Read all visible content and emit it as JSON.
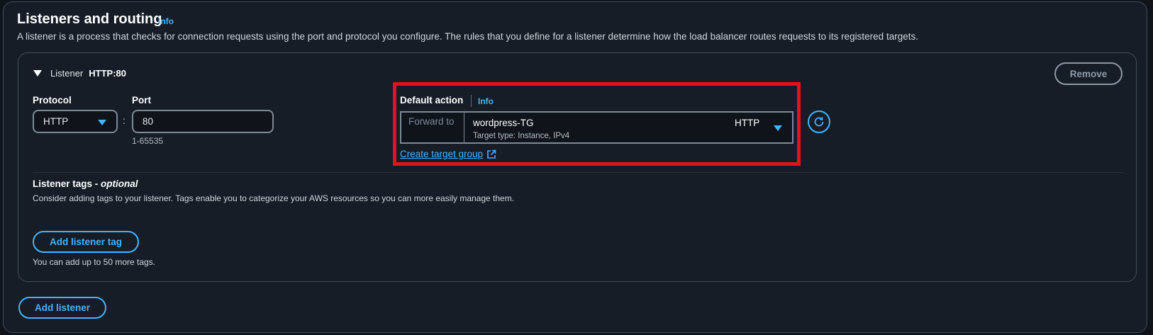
{
  "section": {
    "title": "Listeners and routing",
    "info_label": "Info",
    "description": "A listener is a process that checks for connection requests using the port and protocol you configure. The rules that you define for a listener determine how the load balancer routes requests to its registered targets."
  },
  "listener": {
    "header_label": "Listener",
    "header_value": "HTTP:80",
    "remove_label": "Remove",
    "protocol_label": "Protocol",
    "protocol_value": "HTTP",
    "port_label": "Port",
    "port_value": "80",
    "port_hint": "1-65535",
    "colon": ":"
  },
  "default_action": {
    "label": "Default action",
    "info_label": "Info",
    "forward_to": "Forward to",
    "target_group_name": "wordpress-TG",
    "target_group_sub": "Target type: Instance, IPv4",
    "target_group_protocol": "HTTP",
    "create_link": "Create target group",
    "highlight_color": "#e0141b"
  },
  "tags": {
    "title": "Listener tags - ",
    "title_optional": "optional",
    "description": "Consider adding tags to your listener. Tags enable you to categorize your AWS resources so you can more easily manage them.",
    "add_button": "Add listener tag",
    "hint": "You can add up to 50 more tags."
  },
  "footer": {
    "add_listener_button": "Add listener"
  },
  "colors": {
    "accent": "#42b4ff",
    "background": "#0f141a",
    "panel": "#161d26"
  }
}
